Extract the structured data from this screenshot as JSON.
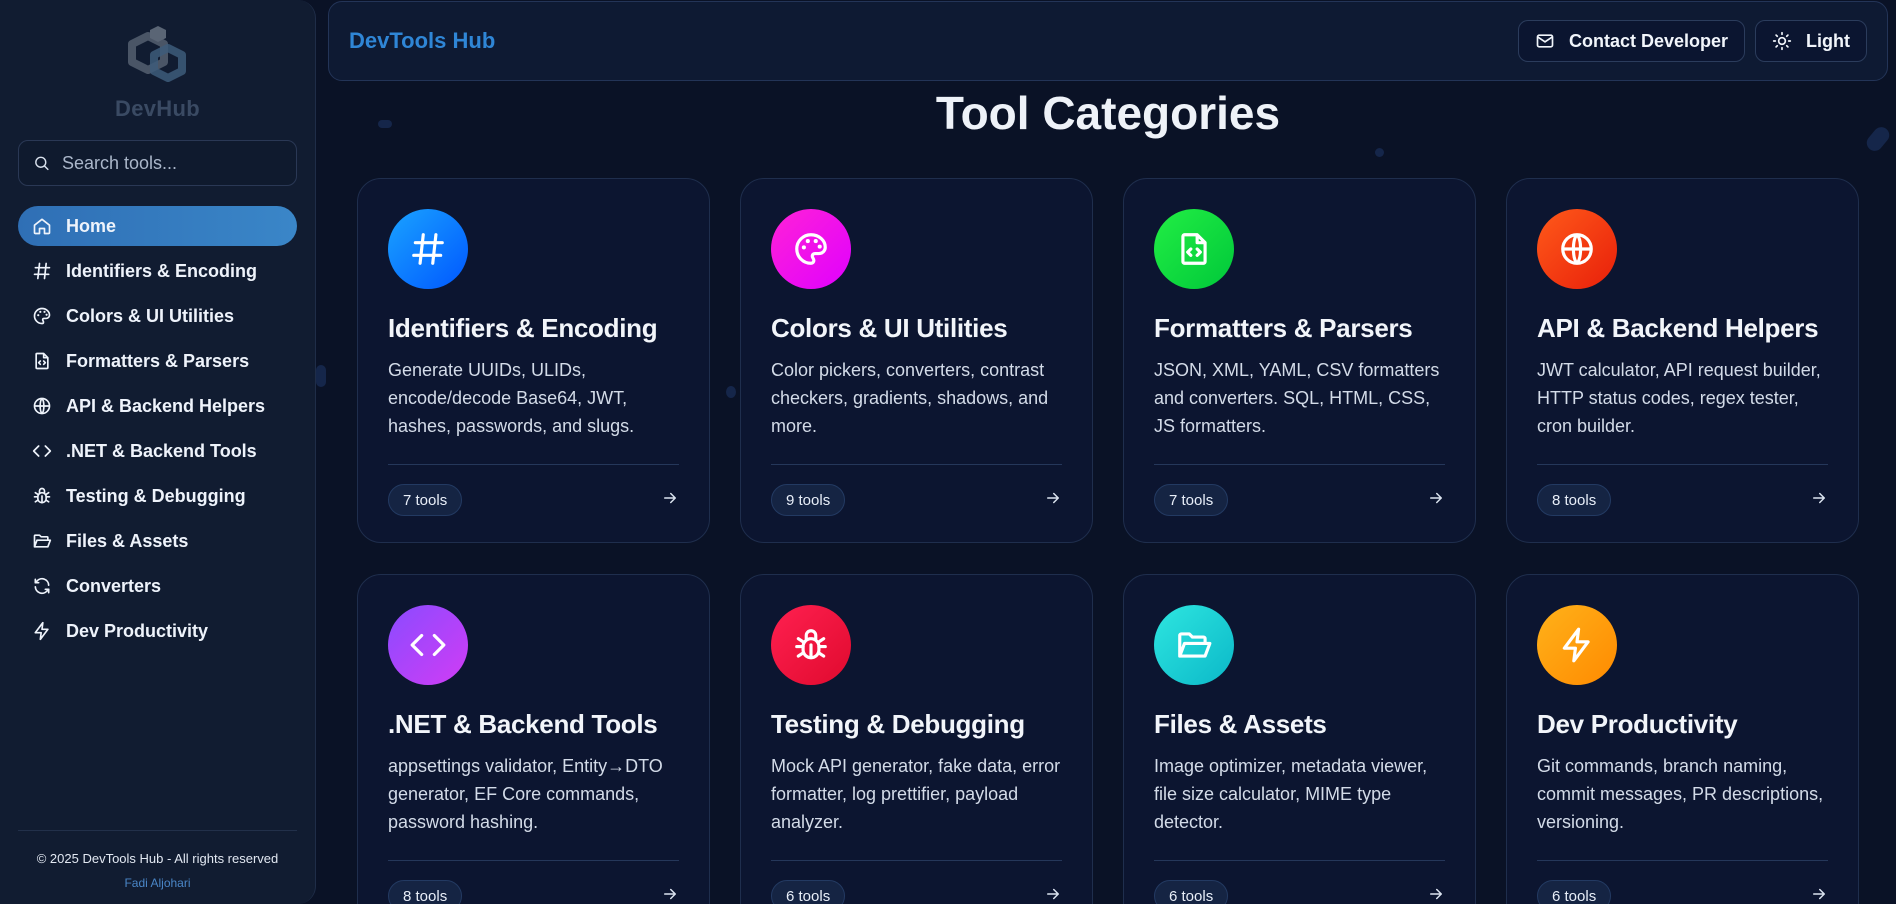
{
  "sidebar": {
    "logo_text": "DevHub",
    "search_placeholder": "Search tools...",
    "items": [
      {
        "label": "Home",
        "icon": "home-icon"
      },
      {
        "label": "Identifiers & Encoding",
        "icon": "hash-icon"
      },
      {
        "label": "Colors & UI Utilities",
        "icon": "palette-icon"
      },
      {
        "label": "Formatters & Parsers",
        "icon": "file-code-icon"
      },
      {
        "label": "API & Backend Helpers",
        "icon": "globe-icon"
      },
      {
        "label": ".NET & Backend Tools",
        "icon": "code-icon"
      },
      {
        "label": "Testing & Debugging",
        "icon": "bug-icon"
      },
      {
        "label": "Files & Assets",
        "icon": "folder-open-icon"
      },
      {
        "label": "Converters",
        "icon": "refresh-icon"
      },
      {
        "label": "Dev Productivity",
        "icon": "zap-icon"
      }
    ],
    "copyright": "© 2025 DevTools Hub - All rights reserved",
    "author": "Fadi Aljohari"
  },
  "header": {
    "brand": "DevTools Hub",
    "contact_label": "Contact Developer",
    "theme_label": "Light"
  },
  "main": {
    "title": "Tool Categories",
    "cards": [
      {
        "title": "Identifiers & Encoding",
        "description": "Generate UUIDs, ULIDs, encode/decode Base64, JWT, hashes, passwords, and slugs.",
        "count": "7 tools",
        "icon": "hash-icon",
        "gradient": [
          "#1aa3ff",
          "#0057ff"
        ]
      },
      {
        "title": "Colors & UI Utilities",
        "description": "Color pickers, converters, contrast checkers, gradients, shadows, and more.",
        "count": "9 tools",
        "icon": "palette-icon",
        "gradient": [
          "#ff22d6",
          "#e000ff"
        ]
      },
      {
        "title": "Formatters & Parsers",
        "description": "JSON, XML, YAML, CSV formatters and converters. SQL, HTML, CSS, JS formatters.",
        "count": "7 tools",
        "icon": "file-code-icon",
        "gradient": [
          "#22ee44",
          "#00c83a"
        ]
      },
      {
        "title": "API & Backend Helpers",
        "description": "JWT calculator, API request builder, HTTP status codes, regex tester, cron builder.",
        "count": "8 tools",
        "icon": "globe-icon",
        "gradient": [
          "#ff5a1a",
          "#e81f0a"
        ]
      },
      {
        "title": ".NET & Backend Tools",
        "description": "appsettings validator, Entity→DTO generator, EF Core commands, password hashing.",
        "count": "8 tools",
        "icon": "code-icon",
        "gradient": [
          "#8a4bff",
          "#d13cf5"
        ]
      },
      {
        "title": "Testing & Debugging",
        "description": "Mock API generator, fake data, error formatter, log prettifier, payload analyzer.",
        "count": "6 tools",
        "icon": "bug-icon",
        "gradient": [
          "#ff2050",
          "#e00a2e"
        ]
      },
      {
        "title": "Files & Assets",
        "description": "Image optimizer, metadata viewer, file size calculator, MIME type detector.",
        "count": "6 tools",
        "icon": "folder-open-icon",
        "gradient": [
          "#2ee6e0",
          "#0bb8c8"
        ]
      },
      {
        "title": "Dev Productivity",
        "description": "Git commands, branch naming, commit messages, PR descriptions, versioning.",
        "count": "6 tools",
        "icon": "zap-icon",
        "gradient": [
          "#ffb21a",
          "#ff8a00"
        ]
      }
    ]
  }
}
